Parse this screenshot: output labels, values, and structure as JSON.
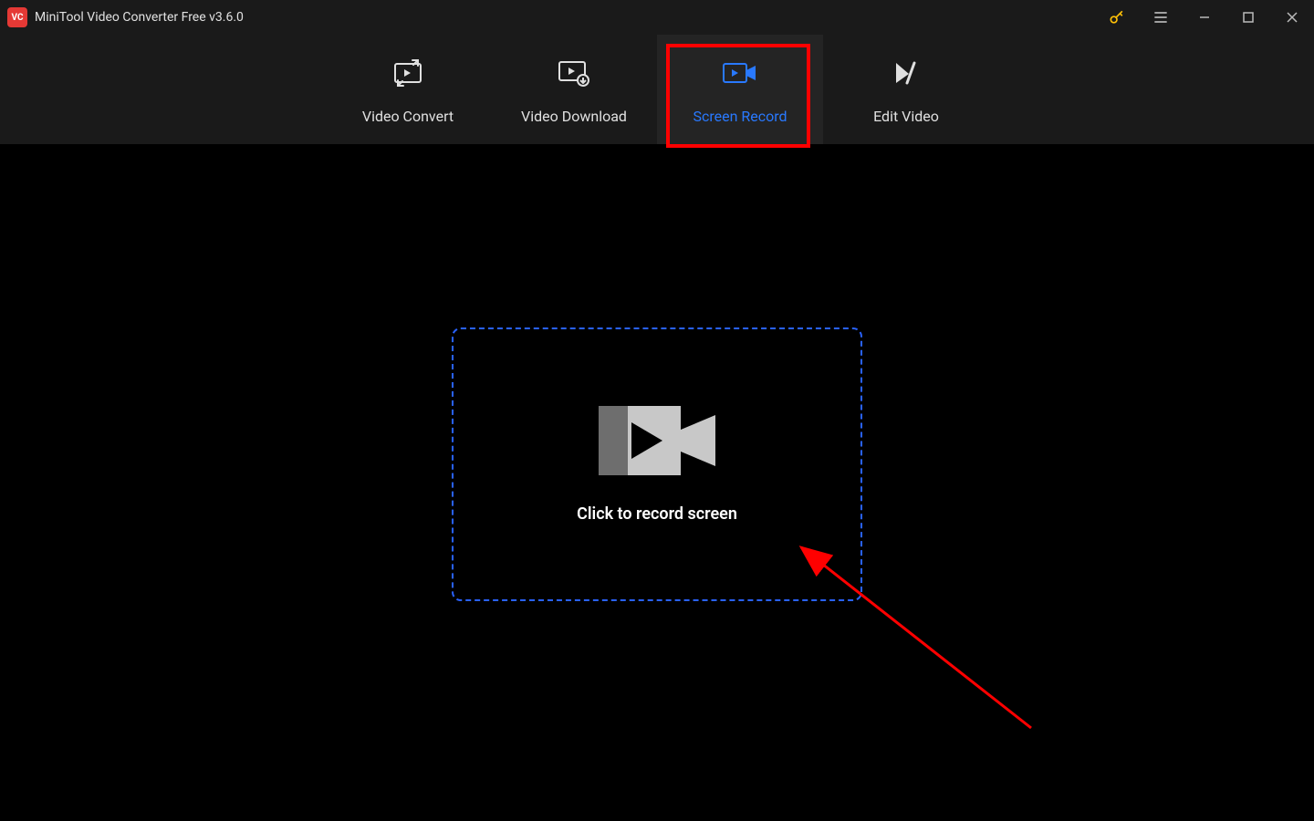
{
  "titleBar": {
    "appName": "MiniTool Video Converter Free v3.6.0",
    "logoText": "VC"
  },
  "tabs": {
    "videoConvert": "Video Convert",
    "videoDownload": "Video Download",
    "screenRecord": "Screen Record",
    "editVideo": "Edit Video"
  },
  "main": {
    "recordPrompt": "Click to record screen"
  }
}
